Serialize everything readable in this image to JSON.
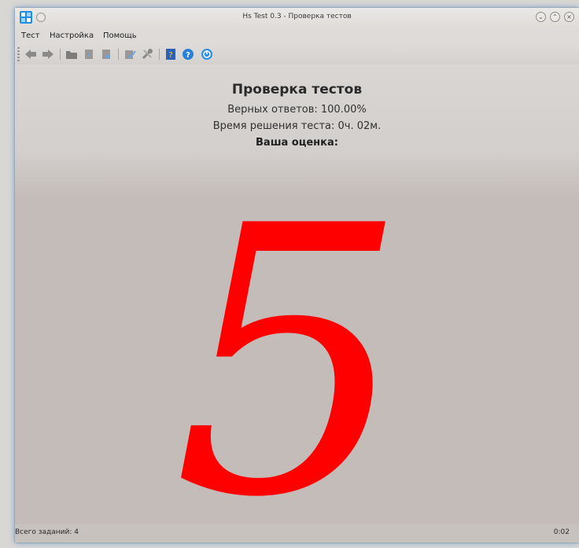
{
  "window": {
    "title": "Hs Test 0.3 - Проверка тестов"
  },
  "menu": {
    "items": [
      "Тест",
      "Настройка",
      "Помощь"
    ]
  },
  "toolbar": {
    "icons": [
      "back-arrow-icon",
      "forward-arrow-icon",
      "open-folder-icon",
      "import-test-icon",
      "export-test-icon",
      "check-test-icon",
      "settings-tools-icon",
      "help-book-icon",
      "help-question-icon",
      "about-info-icon"
    ]
  },
  "result": {
    "title": "Проверка тестов",
    "correct_answers": "Верных ответов: 100.00%",
    "time": "Время решения теста: 0ч. 02м.",
    "grade_label": "Ваша оценка:",
    "grade": "5",
    "grade_color": "#ff0000"
  },
  "status": {
    "total_tasks": "Всего заданий:  4",
    "elapsed": "0:02"
  },
  "colors": {
    "accent_glow": "#2878c8",
    "content_bg": "#c4bcb8"
  }
}
